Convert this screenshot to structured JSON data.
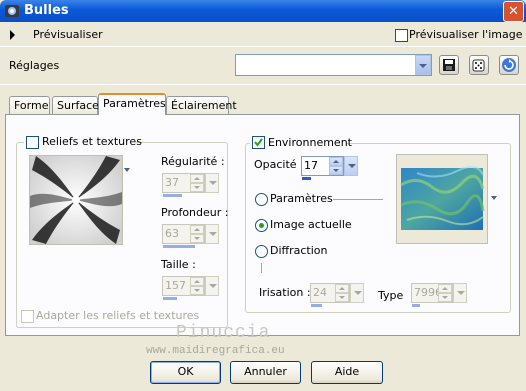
{
  "window": {
    "title": "Bulles",
    "close_glyph": "✕"
  },
  "preview": {
    "label": "Prévisualiser",
    "image_checkbox_label": "Prévisualiser l'image",
    "image_checked": false
  },
  "settings": {
    "label": "Réglages",
    "selected": ""
  },
  "tabs": [
    {
      "label": "Forme"
    },
    {
      "label": "Surface"
    },
    {
      "label": "Paramètres"
    },
    {
      "label": "Éclairement"
    }
  ],
  "left_group": {
    "title": "Reliefs et textures",
    "checked": false,
    "regularite_label": "Régularité :",
    "regularite_value": "37",
    "profondeur_label": "Profondeur :",
    "profondeur_value": "63",
    "taille_label": "Taille :",
    "taille_value": "157",
    "adapt_label": "Adapter les reliefs et textures"
  },
  "right_group": {
    "title": "Environnement",
    "checked": true,
    "opacite_label": "Opacité :",
    "opacite_value": "17",
    "radio_params": "Paramètres",
    "radio_image": "Image actuelle",
    "radio_diffraction": "Diffraction",
    "selected_radio": "Image actuelle",
    "irisation_label": "Irisation :",
    "irisation_value": "24",
    "type_label": "Type",
    "type_value": "7996"
  },
  "watermark": {
    "line1": "Pinuccia",
    "line2": "www.maidiregrafica.eu"
  },
  "buttons": {
    "ok": "OK",
    "cancel": "Annuler",
    "help": "Aide"
  },
  "colors": {
    "title_bar": "#0b58d8",
    "accent_tab": "#e68b2c",
    "check_green": "#21a121"
  }
}
